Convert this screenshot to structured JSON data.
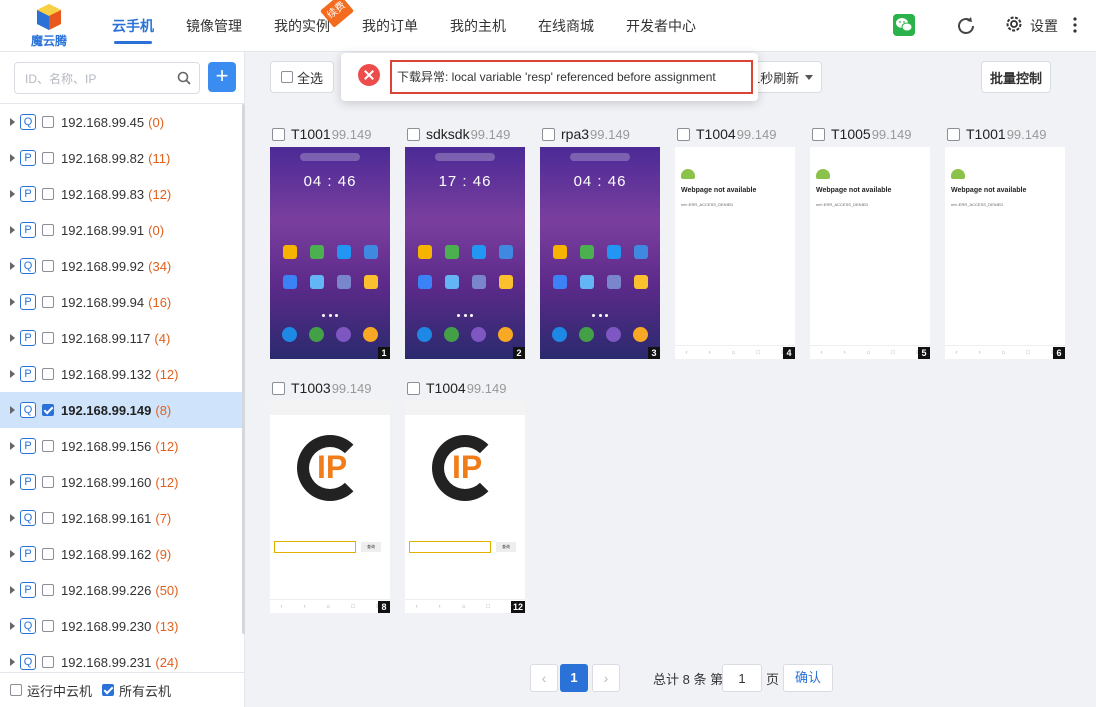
{
  "header": {
    "logo_text": "魔云腾",
    "nav": [
      {
        "label": "云手机",
        "active": true
      },
      {
        "label": "镜像管理"
      },
      {
        "label": "我的实例",
        "badge": "续费"
      },
      {
        "label": "我的订单"
      },
      {
        "label": "我的主机"
      },
      {
        "label": "在线商城"
      },
      {
        "label": "开发者中心"
      }
    ],
    "settings_label": "设置"
  },
  "sidebar": {
    "search_placeholder": "ID、名称、IP",
    "add_label": "+",
    "hosts": [
      {
        "tag": "Q",
        "ip": "192.168.99.45",
        "count": "(0)"
      },
      {
        "tag": "P",
        "ip": "192.168.99.82",
        "count": "(11)"
      },
      {
        "tag": "P",
        "ip": "192.168.99.83",
        "count": "(12)"
      },
      {
        "tag": "P",
        "ip": "192.168.99.91",
        "count": "(0)"
      },
      {
        "tag": "Q",
        "ip": "192.168.99.92",
        "count": "(34)"
      },
      {
        "tag": "P",
        "ip": "192.168.99.94",
        "count": "(16)"
      },
      {
        "tag": "P",
        "ip": "192.168.99.117",
        "count": "(4)"
      },
      {
        "tag": "P",
        "ip": "192.168.99.132",
        "count": "(12)"
      },
      {
        "tag": "Q",
        "ip": "192.168.99.149",
        "count": "(8)",
        "selected": true
      },
      {
        "tag": "P",
        "ip": "192.168.99.156",
        "count": "(12)"
      },
      {
        "tag": "P",
        "ip": "192.168.99.160",
        "count": "(12)"
      },
      {
        "tag": "Q",
        "ip": "192.168.99.161",
        "count": "(7)"
      },
      {
        "tag": "P",
        "ip": "192.168.99.162",
        "count": "(9)"
      },
      {
        "tag": "P",
        "ip": "192.168.99.226",
        "count": "(50)"
      },
      {
        "tag": "Q",
        "ip": "192.168.99.230",
        "count": "(13)"
      },
      {
        "tag": "Q",
        "ip": "192.168.99.231",
        "count": "(24)"
      }
    ],
    "footer": {
      "running_label": "运行中云机",
      "all_label": "所有云机"
    }
  },
  "toolbar": {
    "select_all": "全选",
    "refresh_option": "1秒刷新",
    "batch_control": "批量控制"
  },
  "alert": {
    "message": "下载异常: local variable 'resp' referenced before assignment"
  },
  "cards": [
    {
      "name": "T1001",
      "ip": "99.149",
      "num": "1",
      "screen": "home",
      "clock": "04 : 46"
    },
    {
      "name": "sdksdk",
      "ip": "99.149",
      "num": "2",
      "screen": "home",
      "clock": "17 : 46"
    },
    {
      "name": "rpa3",
      "ip": "99.149",
      "num": "3",
      "screen": "home",
      "clock": "04 : 46"
    },
    {
      "name": "T1004",
      "ip": "99.149",
      "num": "4",
      "screen": "error",
      "err_title": "Webpage not available",
      "err_code": "net::ERR_ACCESS_DENIED"
    },
    {
      "name": "T1005",
      "ip": "99.149",
      "num": "5",
      "screen": "error",
      "err_title": "Webpage not available",
      "err_code": "net::ERR_ACCESS_DENIED"
    },
    {
      "name": "T1001",
      "ip": "99.149",
      "num": "6",
      "screen": "error",
      "err_title": "Webpage not available",
      "err_code": "net::ERR_ACCESS_DENIED"
    },
    {
      "name": "T1003",
      "ip": "99.149",
      "num": "8",
      "screen": "ipweb",
      "go_label": "查询"
    },
    {
      "name": "T1004",
      "ip": "99.149",
      "num": "12",
      "screen": "ipweb",
      "go_label": "查询"
    }
  ],
  "pagination": {
    "prev": "‹",
    "current": "1",
    "next": "›",
    "total_text": "总计 8 条  第",
    "page_input": "1",
    "page_unit": "页",
    "confirm": "确认"
  },
  "colors": {
    "accent": "#2a72d8",
    "count": "#e0601c",
    "alert_border": "#d94434",
    "alert_icon": "#ee4b4b",
    "selected_row": "#cfe3fb"
  }
}
